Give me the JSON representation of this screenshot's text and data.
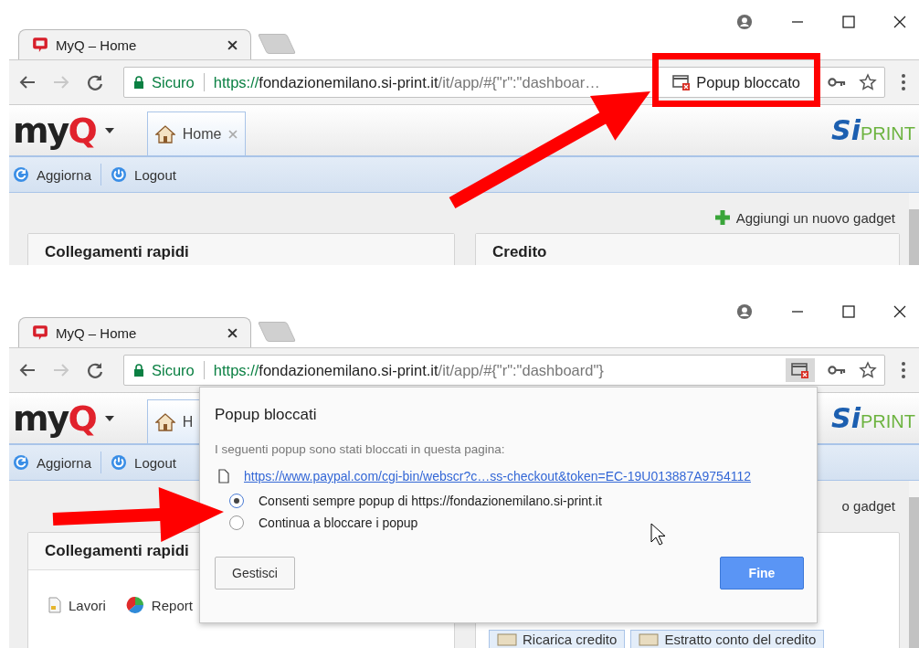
{
  "screens": [
    {
      "tab": {
        "title": "MyQ – Home"
      },
      "address": {
        "secure_label": "Sicuro",
        "scheme": "https://",
        "host": "fondazionemilano.si-print.it",
        "path": "/it/app/#{\"r\":\"dashboar…",
        "popup_indicator": {
          "label": "Popup bloccato",
          "pressed": false
        }
      },
      "app": {
        "logo": {
          "text": "my",
          "accent": "Q"
        },
        "home_tab": "Home",
        "brand": {
          "si": "Si",
          "print": "PRINT"
        }
      },
      "toolbar": [
        {
          "label": "Aggiorna",
          "kind": "refresh"
        },
        {
          "label": "Logout",
          "kind": "power"
        }
      ],
      "gadget_link": {
        "label": "Aggiungi un nuovo gadget",
        "icon": true
      },
      "cards": [
        {
          "title": "Collegamenti rapidi"
        },
        {
          "title": "Credito"
        }
      ]
    },
    {
      "tab": {
        "title": "MyQ – Home"
      },
      "address": {
        "secure_label": "Sicuro",
        "scheme": "https://",
        "host": "fondazionemilano.si-print.it",
        "path": "/it/app/#{\"r\":\"dashboard\"}",
        "popup_indicator": {
          "pressed": true
        }
      },
      "app": {
        "logo": {
          "text": "my",
          "accent": "Q"
        },
        "home_tab": "H",
        "brand": {
          "si": "Si",
          "print": "PRINT"
        }
      },
      "toolbar": [
        {
          "label": "Aggiorna",
          "kind": "refresh"
        },
        {
          "label": "Logout",
          "kind": "power"
        }
      ],
      "gadget_link": {
        "label": "o gadget",
        "icon": false
      },
      "cards": [
        {
          "title": "Collegamenti rapidi",
          "links": [
            {
              "label": "Lavori",
              "kind": "document"
            },
            {
              "label": "Report",
              "kind": "chart"
            }
          ]
        },
        {
          "buttons": [
            "Ricarica credito",
            "Estratto conto del credito"
          ]
        }
      ],
      "popup": {
        "title": "Popup bloccati",
        "message": "I seguenti popup sono stati bloccati in questa pagina:",
        "link": "https://www.paypal.com/cgi-bin/webscr?c…ss-checkout&token=EC-19U013887A9754112",
        "options": [
          {
            "label": "Consenti sempre popup di https://fondazionemilano.si-print.it",
            "selected": true
          },
          {
            "label": "Continua a bloccare i popup",
            "selected": false
          }
        ],
        "buttons": [
          {
            "label": "Gestisci",
            "kind": "secondary"
          },
          {
            "label": "Fine",
            "kind": "primary"
          }
        ]
      }
    }
  ]
}
